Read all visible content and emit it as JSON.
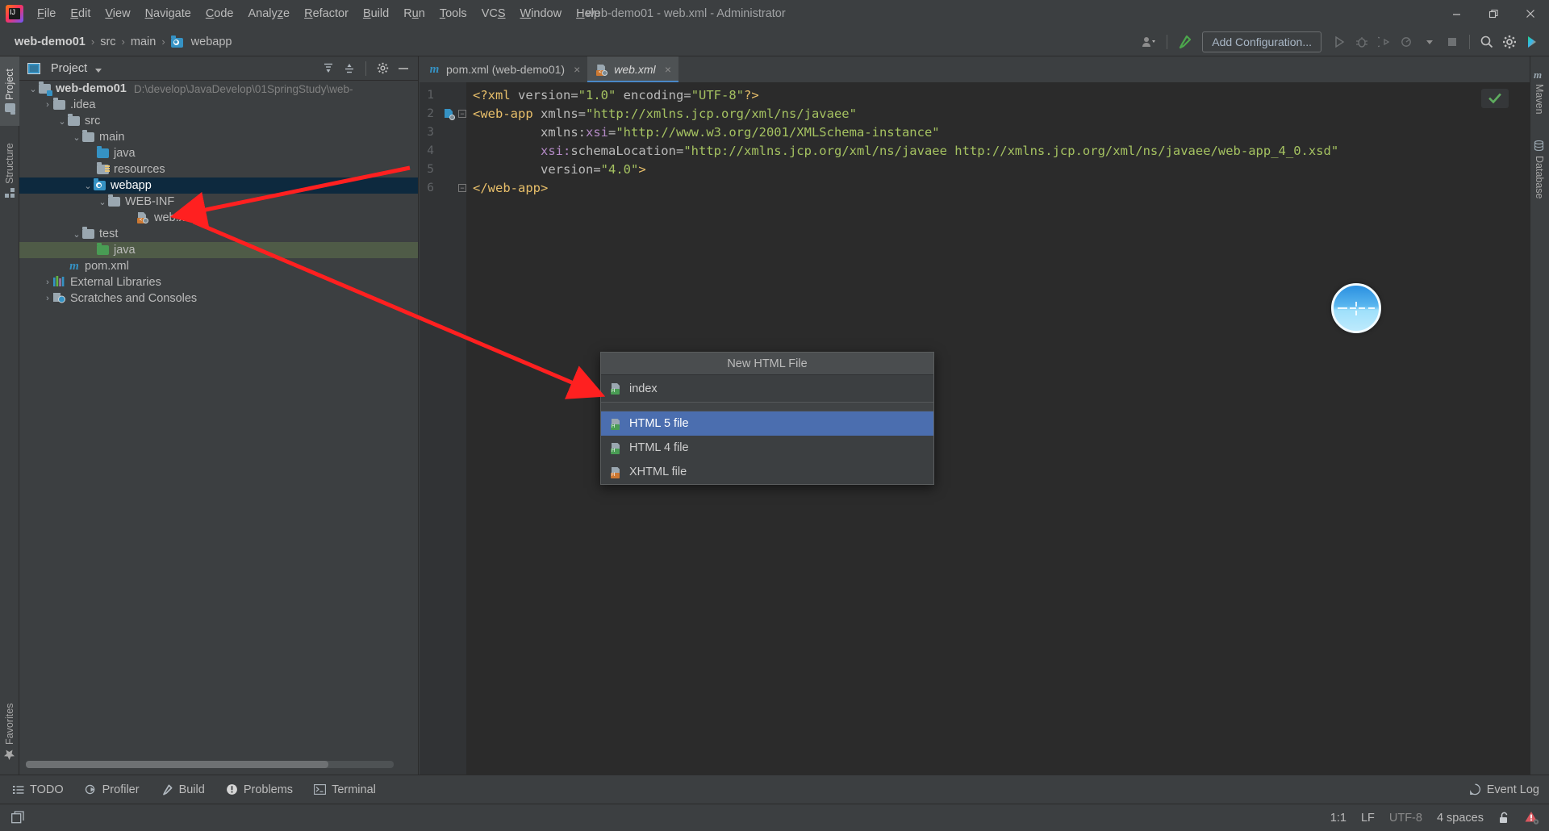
{
  "window": {
    "title": "web-demo01 - web.xml - Administrator",
    "controls": {
      "minimize": "minimize-icon",
      "maximize": "maximize-icon",
      "close": "close-icon"
    }
  },
  "menubar": {
    "items": [
      {
        "label": "File",
        "mnemonic": "F"
      },
      {
        "label": "Edit",
        "mnemonic": "E"
      },
      {
        "label": "View",
        "mnemonic": "V"
      },
      {
        "label": "Navigate",
        "mnemonic": "N"
      },
      {
        "label": "Code",
        "mnemonic": "C"
      },
      {
        "label": "Analyze",
        "mnemonic": "z"
      },
      {
        "label": "Refactor",
        "mnemonic": "R"
      },
      {
        "label": "Build",
        "mnemonic": "B"
      },
      {
        "label": "Run",
        "mnemonic": "u"
      },
      {
        "label": "Tools",
        "mnemonic": "T"
      },
      {
        "label": "VCS",
        "mnemonic": "S"
      },
      {
        "label": "Window",
        "mnemonic": "W"
      },
      {
        "label": "Help",
        "mnemonic": "H"
      }
    ]
  },
  "navbar": {
    "breadcrumbs": [
      "web-demo01",
      "src",
      "main",
      "webapp"
    ],
    "add_configuration_label": "Add Configuration...",
    "icons": [
      "user-dropdown-icon",
      "hammer-icon",
      "run-icon",
      "debug-icon",
      "run-with-coverage-icon",
      "profiler-icon",
      "stop-icon",
      "search-icon",
      "settings-gear-icon",
      "ide-assistant-icon"
    ]
  },
  "left_strip": {
    "tabs": [
      {
        "label": "Project",
        "icon": "project-icon",
        "active": true
      },
      {
        "label": "Structure",
        "icon": "structure-icon",
        "active": false
      },
      {
        "label": "Favorites",
        "icon": "star-icon",
        "active": false
      }
    ]
  },
  "right_strip": {
    "tabs": [
      {
        "label": "Maven",
        "icon": "maven-icon"
      },
      {
        "label": "Database",
        "icon": "database-icon"
      }
    ]
  },
  "project_panel": {
    "title": "Project",
    "header_buttons": [
      "expand-all-icon",
      "collapse-all-icon",
      "settings-gear-icon",
      "hide-icon"
    ],
    "tree": [
      {
        "label": "web-demo01",
        "path": "D:\\develop\\JavaDevelop\\01SpringStudy\\web-",
        "depth": 0,
        "arrow": "down",
        "icon": "module-folder-icon",
        "bold": true
      },
      {
        "label": ".idea",
        "depth": 1,
        "arrow": "right",
        "icon": "folder-icon"
      },
      {
        "label": "src",
        "depth": 1,
        "arrow": "down",
        "icon": "folder-icon"
      },
      {
        "label": "main",
        "depth": 2,
        "arrow": "down",
        "icon": "folder-icon"
      },
      {
        "label": "java",
        "depth": 3,
        "arrow": "none",
        "icon": "sources-folder-icon"
      },
      {
        "label": "resources",
        "depth": 3,
        "arrow": "none",
        "icon": "resources-folder-icon"
      },
      {
        "label": "webapp",
        "depth": 3,
        "arrow": "down",
        "icon": "webapp-folder-icon",
        "selected": true
      },
      {
        "label": "WEB-INF",
        "depth": 4,
        "arrow": "down",
        "icon": "folder-icon"
      },
      {
        "label": "web.xml",
        "depth": 5,
        "arrow": "none",
        "icon": "xml-file-icon"
      },
      {
        "label": "test",
        "depth": 2,
        "arrow": "down",
        "icon": "folder-icon"
      },
      {
        "label": "java",
        "depth": 3,
        "arrow": "none",
        "icon": "test-sources-folder-icon",
        "green": true
      },
      {
        "label": "pom.xml",
        "depth": 2,
        "arrow": "none",
        "icon": "maven-file-icon"
      },
      {
        "label": "External Libraries",
        "depth": 0,
        "arrow": "right",
        "icon": "libraries-icon"
      },
      {
        "label": "Scratches and Consoles",
        "depth": 0,
        "arrow": "right",
        "icon": "scratches-icon"
      }
    ]
  },
  "editor": {
    "tabs": [
      {
        "label": "pom.xml (web-demo01)",
        "icon": "maven-file-icon",
        "active": false,
        "close": "×"
      },
      {
        "label": "web.xml",
        "icon": "xml-file-icon",
        "active": true,
        "close": "×"
      }
    ],
    "line_numbers": [
      "1",
      "2",
      "3",
      "4",
      "5",
      "6"
    ],
    "lines": [
      "<?xml version=\"1.0\" encoding=\"UTF-8\"?>",
      "<web-app xmlns=\"http://xmlns.jcp.org/xml/ns/javaee\"",
      "         xmlns:xsi=\"http://www.w3.org/2001/XMLSchema-instance\"",
      "         xsi:schemaLocation=\"http://xmlns.jcp.org/xml/ns/javaee http://xmlns.jcp.org/xml/ns/javaee/web-app_4_0.xsd\"",
      "         version=\"4.0\">",
      "</web-app>"
    ],
    "inspection_status": "ok-checkmark-icon"
  },
  "popup": {
    "title": "New HTML File",
    "input_value": "index",
    "input_icon": "html-file-icon",
    "items": [
      {
        "label": "HTML 5 file",
        "icon": "html-file-icon",
        "selected": true
      },
      {
        "label": "HTML 4 file",
        "icon": "html-file-icon",
        "selected": false
      },
      {
        "label": "XHTML file",
        "icon": "xhtml-file-icon",
        "selected": false
      }
    ]
  },
  "bottom_bar": {
    "items": [
      {
        "label": "TODO",
        "icon": "todo-list-icon"
      },
      {
        "label": "Profiler",
        "icon": "profiler-icon"
      },
      {
        "label": "Build",
        "icon": "hammer-icon"
      },
      {
        "label": "Problems",
        "icon": "problems-icon"
      },
      {
        "label": "Terminal",
        "icon": "terminal-icon"
      }
    ],
    "event_log_label": "Event Log",
    "event_log_icon": "event-log-icon"
  },
  "status_bar": {
    "caret_position": "1:1",
    "line_separator": "LF",
    "encoding": "UTF-8",
    "indent": "4 spaces",
    "lock_icon": "unlocked-icon",
    "notification_icon": "error-notification-icon",
    "layout_icon": "toggle-layout-icon"
  },
  "colors": {
    "background": "#3c3f41",
    "editor_background": "#2b2b2b",
    "selection_blue": "#0d293e",
    "popup_selection": "#4b6eaf",
    "test_green": "#4f5b47",
    "annotation_red": "#ff2020",
    "accent": "#4a88c7"
  }
}
